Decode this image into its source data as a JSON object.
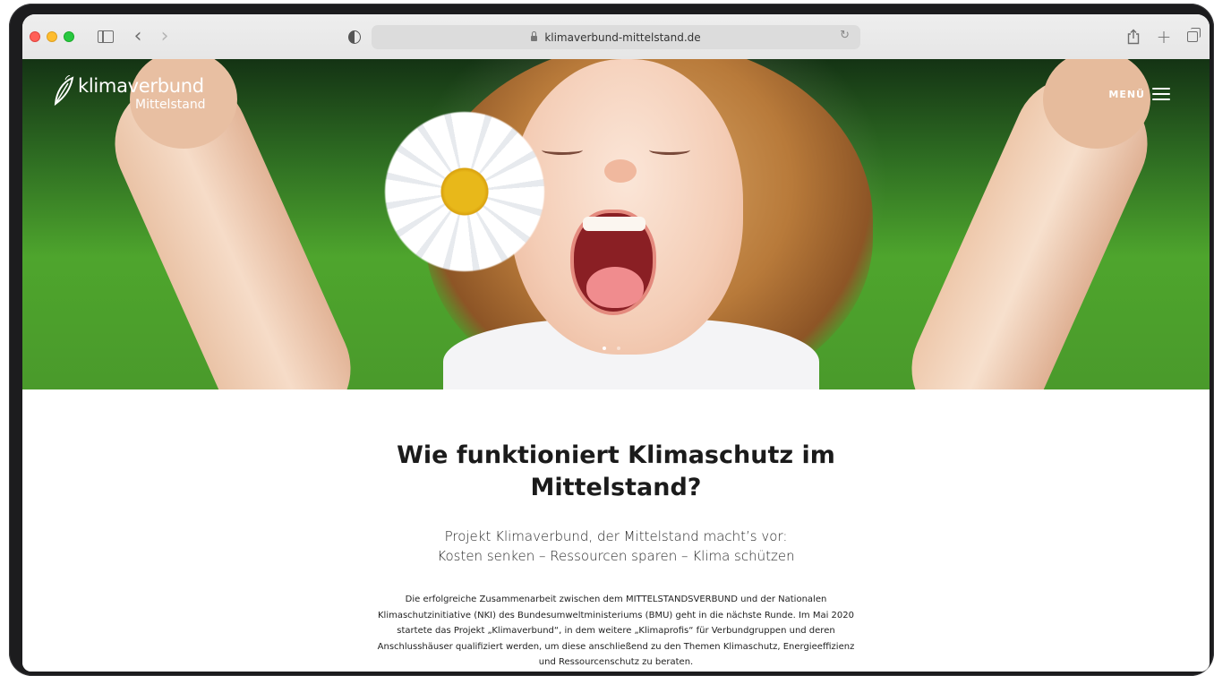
{
  "browser": {
    "url": "klimaverbund-mittelstand.de"
  },
  "site": {
    "logo": {
      "main": "klimaverbund",
      "sub": "Mittelstand"
    },
    "menu_label": "MENÜ"
  },
  "hero": {
    "slide_count": 2,
    "active_slide": 1
  },
  "content": {
    "headline_line1": "Wie funktioniert Klimaschutz im",
    "headline_line2": "Mittelstand?",
    "sub_line1": "Projekt Klimaverbund, der Mittelstand macht’s vor:",
    "sub_line2": "Kosten senken – Ressourcen sparen – Klima schützen",
    "body": "Die erfolgreiche Zusammenarbeit zwischen dem MITTELSTANDSVERBUND und der Nationalen Klimaschutzinitiative (NKI) des Bundesumweltministeriums (BMU) geht in die nächste Runde. Im Mai 2020 startete das Projekt „Klimaverbund“, in dem weitere „Klimaprofis“ für Verbundgruppen und deren Anschlusshäuser qualifiziert werden, um diese anschließend zu den Themen Klimaschutz, Energieeffizienz und Ressourcenschutz zu beraten."
  }
}
